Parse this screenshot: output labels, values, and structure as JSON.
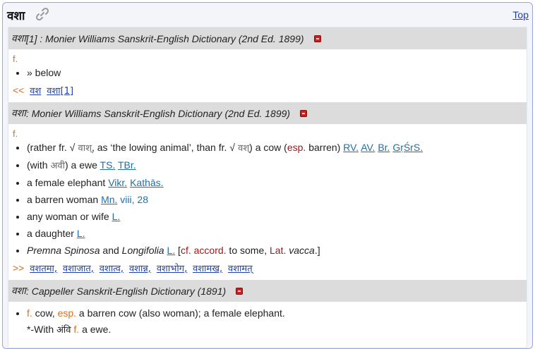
{
  "page": {
    "title": "वशा",
    "top_link": "Top"
  },
  "sections": [
    {
      "header": {
        "headword": "वशा",
        "suffix": "[1] : Monier Williams Sanskrit-English Dictionary (2nd Ed. 1899)"
      },
      "gender": "f.",
      "items": [
        {
          "text": "» below"
        }
      ],
      "nav": {
        "arrows": "<<",
        "links": [
          "वश",
          "वशा[1]"
        ]
      }
    },
    {
      "header": {
        "headword": "वशा",
        "suffix": " : Monier Williams Sanskrit-English Dictionary (2nd Ed. 1899)"
      },
      "gender": "f.",
      "items": [
        {
          "p1": "(rather fr. √",
          "dev1": " वाश्",
          "p2": ", as ‘the lowing animal’, than fr. √",
          "dev2": " वश्",
          "p3": ") a cow (",
          "esp": "esp.",
          "p4": " barren) ",
          "refs": [
            "RV.",
            "AV.",
            "Br.",
            "GṛŚrS."
          ]
        },
        {
          "p1": "(with ",
          "dev1": "अवी",
          "p2": ") a ewe ",
          "refs": [
            "TS.",
            "TBr."
          ]
        },
        {
          "p1": "a female elephant ",
          "refs": [
            "Vikr.",
            "Kathās."
          ]
        },
        {
          "p1": "a barren woman ",
          "refs": [
            "Mn."
          ],
          "tail": " viii, 28"
        },
        {
          "p1": "any woman or wife ",
          "refs": [
            "L."
          ]
        },
        {
          "p1": "a daughter ",
          "refs": [
            "L."
          ]
        },
        {
          "i1": "Premna Spinosa",
          "p1": " and ",
          "i2": "Longifolia",
          "p2": " ",
          "refs": [
            "L."
          ],
          "p3": " [",
          "cf": "cf. accord.",
          "p4": " to some, ",
          "lat": "Lat.",
          "p5": " ",
          "i3": "vacca",
          "p6": ".]"
        }
      ],
      "nav": {
        "arrows": ">>",
        "links": [
          "वशतमा,",
          "वशाजात,",
          "वशात्व,",
          "वशान्न,",
          "वशाभोग,",
          "वशामख,",
          "वशामत्"
        ]
      }
    },
    {
      "header": {
        "headword": "वशा",
        "suffix": " : Cappeller Sanskrit-English Dictionary (1891)"
      },
      "items": [
        {
          "g1": "f.",
          "p1": " cow, ",
          "esp": "esp.",
          "p2": " a barren cow (also woman); a female elephant."
        }
      ],
      "with_line": {
        "p1": "*-With ",
        "dev": "अंवि",
        "p2": " ",
        "g": "f.",
        "p3": " a ewe."
      }
    }
  ],
  "icons": {
    "link": "link-icon",
    "pdf": "pdf-icon"
  }
}
